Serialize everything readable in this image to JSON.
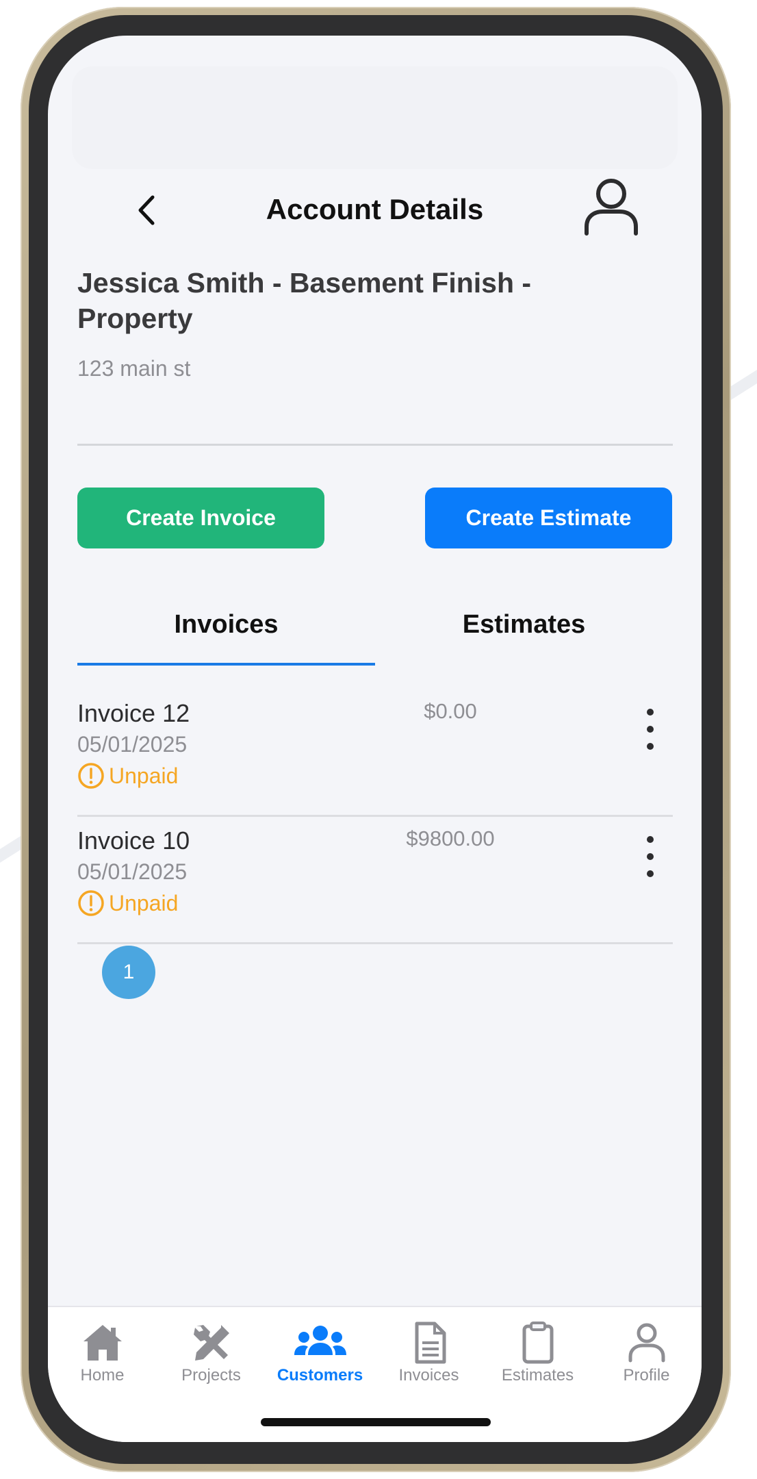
{
  "header": {
    "title": "Account Details"
  },
  "account": {
    "name": "Jessica Smith - Basement Finish - Property",
    "address": "123 main st"
  },
  "actions": {
    "create_invoice": "Create Invoice",
    "create_estimate": "Create Estimate"
  },
  "tabs": [
    {
      "label": "Invoices",
      "active": true
    },
    {
      "label": "Estimates",
      "active": false
    }
  ],
  "invoices": [
    {
      "name": "Invoice 12",
      "date": "05/01/2025",
      "status": "Unpaid",
      "amount": "$0.00"
    },
    {
      "name": "Invoice 10",
      "date": "05/01/2025",
      "status": "Unpaid",
      "amount": "$9800.00"
    }
  ],
  "pagination": {
    "current_page": "1"
  },
  "bottom_nav": [
    {
      "label": "Home",
      "icon": "home-icon",
      "active": false
    },
    {
      "label": "Projects",
      "icon": "tools-icon",
      "active": false
    },
    {
      "label": "Customers",
      "icon": "users-icon",
      "active": true
    },
    {
      "label": "Invoices",
      "icon": "document-icon",
      "active": false
    },
    {
      "label": "Estimates",
      "icon": "clipboard-icon",
      "active": false
    },
    {
      "label": "Profile",
      "icon": "person-icon",
      "active": false
    }
  ],
  "colors": {
    "create_invoice": "#21b57a",
    "create_estimate": "#0a7cfa",
    "active_tab_underline": "#1a7be6",
    "status_unpaid": "#f5a623",
    "pagination_active": "#4ba6e0",
    "nav_active": "#0a7cfa",
    "nav_inactive": "#8e8e93"
  }
}
